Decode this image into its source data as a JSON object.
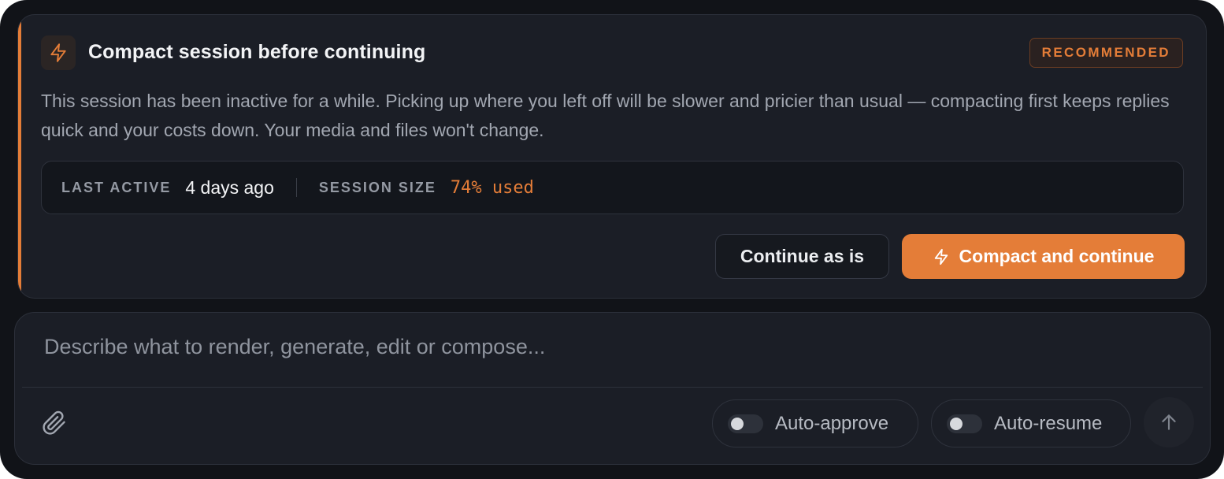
{
  "prompt": {
    "title": "Compact session before continuing",
    "badge": "RECOMMENDED",
    "description": "This session has been inactive for a while. Picking up where you left off will be slower and pricier than usual — compacting first keeps replies quick and your costs down. Your media and files won't change.",
    "stats": {
      "last_active_label": "LAST ACTIVE",
      "last_active_value": "4 days ago",
      "session_size_label": "SESSION SIZE",
      "session_size_value": "74% used"
    },
    "continue_label": "Continue as is",
    "compact_label": "Compact and continue",
    "icon": "lightning-bolt-icon"
  },
  "composer": {
    "placeholder": "Describe what to render, generate, edit or compose...",
    "auto_approve_label": "Auto-approve",
    "auto_approve_on": false,
    "auto_resume_label": "Auto-resume",
    "auto_resume_on": false,
    "attach_icon": "paperclip-icon",
    "send_icon": "arrow-up-icon"
  },
  "colors": {
    "accent": "#e47d38",
    "background": "#111318",
    "card": "#1b1e26"
  }
}
